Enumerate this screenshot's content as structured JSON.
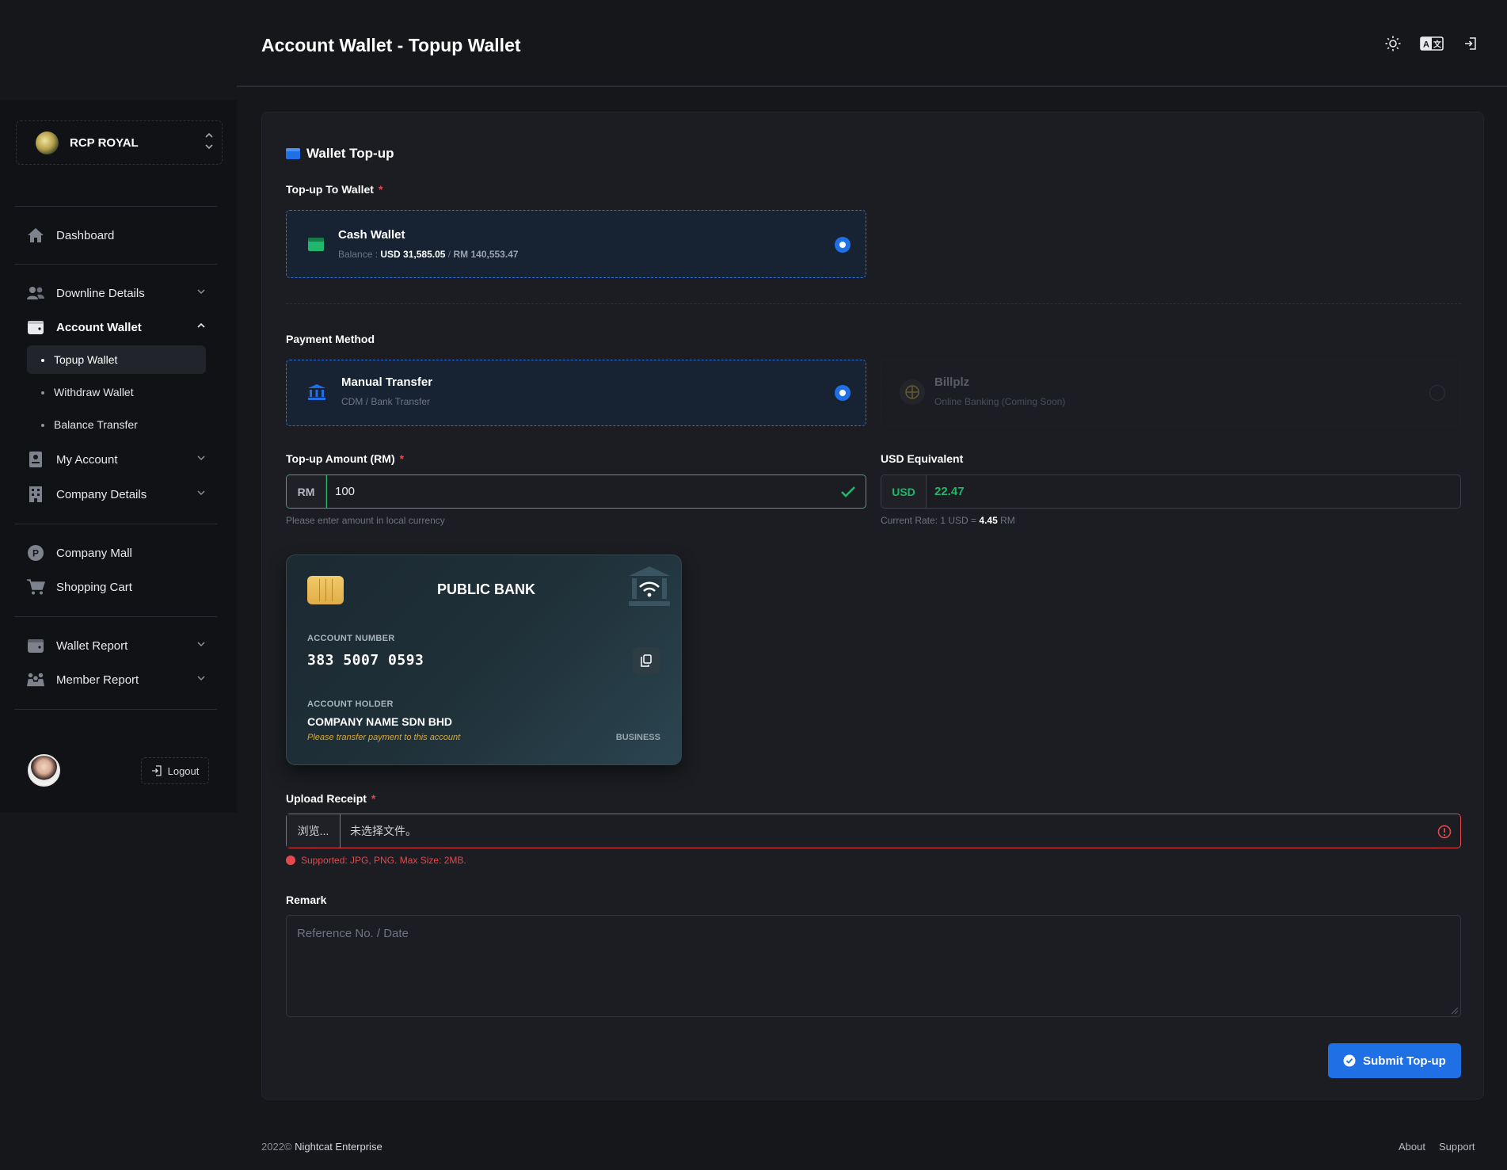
{
  "header": {
    "title": "Account Wallet - Topup Wallet",
    "icons": [
      "sun-icon",
      "translate-icon",
      "logout-icon"
    ]
  },
  "sidebar": {
    "brand": "RCP ROYAL",
    "items": [
      {
        "label": "Dashboard",
        "icon": "home-icon"
      },
      {
        "label": "Downline Details",
        "icon": "users-icon"
      },
      {
        "label": "Account Wallet",
        "icon": "wallet-icon"
      },
      {
        "label": "My Account",
        "icon": "id-card-icon"
      },
      {
        "label": "Company Details",
        "icon": "building-icon"
      },
      {
        "label": "Company Mall",
        "icon": "mall-icon"
      },
      {
        "label": "Shopping Cart",
        "icon": "cart-icon"
      },
      {
        "label": "Wallet Report",
        "icon": "wallet-report-icon"
      },
      {
        "label": "Member Report",
        "icon": "member-report-icon"
      }
    ],
    "subitems": [
      {
        "label": "Topup Wallet",
        "active": true
      },
      {
        "label": "Withdraw Wallet",
        "active": false
      },
      {
        "label": "Balance Transfer",
        "active": false
      }
    ],
    "logout_label": "Logout"
  },
  "form": {
    "card_title": "Wallet Top-up",
    "topup_to_label": "Top-up To Wallet",
    "required_mark": "*",
    "wallet": {
      "name": "Cash Wallet",
      "balance_label": "Balance :",
      "balance_usd": "USD 31,585.05",
      "separator": "/",
      "balance_rm": "RM 140,553.47"
    },
    "payment_method_label": "Payment Method",
    "methods": [
      {
        "name": "Manual Transfer",
        "sub": "CDM / Bank Transfer",
        "selected": true
      },
      {
        "name": "Billplz",
        "sub": "Online Banking (Coming Soon)",
        "selected": false
      }
    ],
    "amount_label": "Top-up Amount (RM)",
    "amount_prefix": "RM",
    "amount_value": "100",
    "amount_hint": "Please enter amount in local currency",
    "usd_label": "USD Equivalent",
    "usd_prefix": "USD",
    "usd_value": "22.47",
    "rate_prefix": "Current Rate: 1 USD =",
    "rate_value": "4.45",
    "rate_suffix": "RM",
    "bank": {
      "name": "PUBLIC BANK",
      "account_number_label": "ACCOUNT NUMBER",
      "account_number": "383 5007 0593",
      "account_holder_label": "ACCOUNT HOLDER",
      "account_holder": "COMPANY NAME SDN BHD",
      "note": "Please transfer payment to this account",
      "type": "BUSINESS"
    },
    "upload_label": "Upload Receipt",
    "upload_button": "浏览...",
    "upload_filename": "未选择文件。",
    "upload_error": "Supported: JPG, PNG. Max Size: 2MB.",
    "remark_label": "Remark",
    "remark_placeholder": "Reference No. / Date",
    "submit_label": "Submit Top-up"
  },
  "footer": {
    "year": "2022©",
    "company": "Nightcat Enterprise",
    "links": [
      "About",
      "Support"
    ]
  },
  "colors": {
    "accent": "#1f6fe5",
    "success": "#1fb86a",
    "danger": "#e5484d",
    "bank_note": "#d8a83e"
  }
}
